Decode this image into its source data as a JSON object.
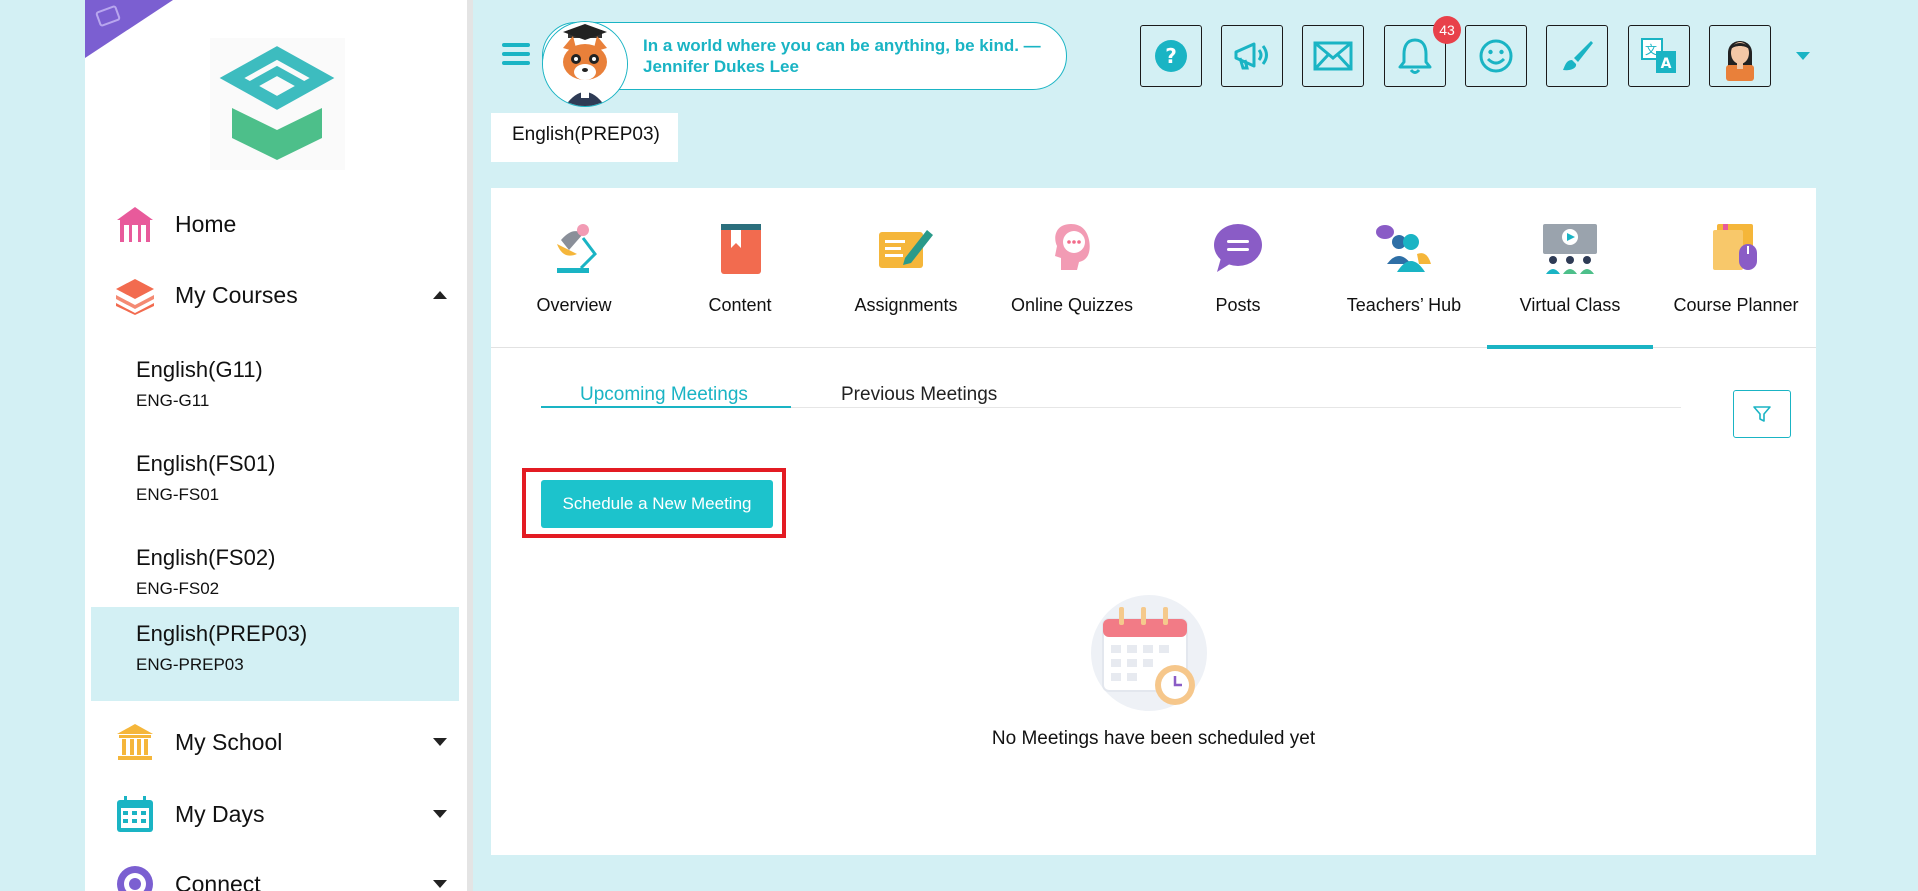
{
  "sidebar": {
    "nav": [
      {
        "label": "Home",
        "icon": "home-icon",
        "color": "#e85a9b"
      },
      {
        "label": "My Courses",
        "icon": "courses-icon",
        "color": "#f26b4f",
        "expanded": true
      }
    ],
    "courses": [
      {
        "name": "English(G11)",
        "code": "ENG-G11"
      },
      {
        "name": "English(FS01)",
        "code": "ENG-FS01"
      },
      {
        "name": "English(FS02)",
        "code": "ENG-FS02"
      },
      {
        "name": "English(PREP03)",
        "code": "ENG-PREP03",
        "active": true
      }
    ],
    "nav_bottom": [
      {
        "label": "My School",
        "icon": "school-icon",
        "color": "#f5b63a"
      },
      {
        "label": "My Days",
        "icon": "calendar-icon",
        "color": "#1ab4c4"
      },
      {
        "label": "Connect",
        "icon": "connect-icon",
        "color": "#7b5fd1"
      }
    ]
  },
  "header": {
    "quote": "In a world where you can be anything, be kind. — Jennifer Dukes Lee",
    "notification_count": "43",
    "buttons": [
      "help-icon",
      "announcement-icon",
      "mail-icon",
      "bell-icon",
      "smiley-icon",
      "brush-icon",
      "translate-icon",
      "profile-avatar"
    ]
  },
  "breadcrumb": "English(PREP03)",
  "tabs": [
    {
      "label": "Overview",
      "icon": "lamp-icon"
    },
    {
      "label": "Content",
      "icon": "book-icon"
    },
    {
      "label": "Assignments",
      "icon": "assignment-pen-icon"
    },
    {
      "label": "Online Quizzes",
      "icon": "quiz-head-icon"
    },
    {
      "label": "Posts",
      "icon": "chat-bubble-icon"
    },
    {
      "label": "Teachers’ Hub",
      "icon": "teachers-group-icon"
    },
    {
      "label": "Virtual Class",
      "icon": "virtual-class-icon",
      "active": true
    },
    {
      "label": "Course Planner",
      "icon": "planner-icon"
    }
  ],
  "subtabs": {
    "upcoming": "Upcoming Meetings",
    "previous": "Previous Meetings"
  },
  "schedule_button": "Schedule a New Meeting",
  "empty_message": "No Meetings have been scheduled yet",
  "colors": {
    "accent": "#1ab4c4",
    "background": "#d3f0f4",
    "highlight": "#e31b23",
    "badge": "#e8414a"
  }
}
